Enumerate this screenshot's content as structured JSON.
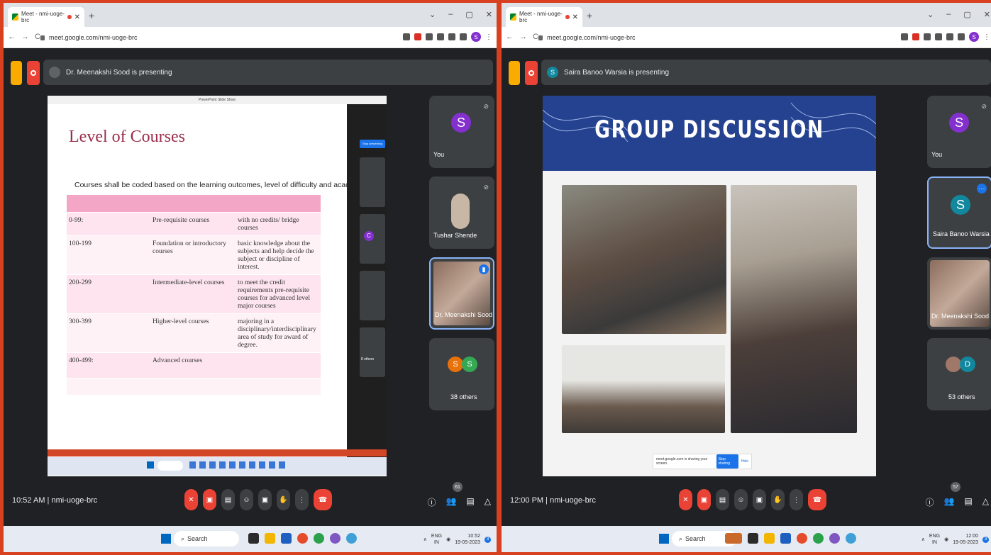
{
  "left": {
    "tab_title": "Meet - nmi-uoge-brc",
    "url": "meet.google.com/nmi-uoge-brc",
    "presenter_text": "Dr. Meenakshi Sood is presenting",
    "slide": {
      "title": "Level of Courses",
      "subtitle": "Courses shall be coded based on the learning outcomes, level of difficulty and academic rigor.",
      "rows": [
        [
          "0-99:",
          "Pre-requisite courses",
          "with no credits/ bridge courses"
        ],
        [
          "100-199",
          "Foundation or introductory courses",
          "basic knowledge about the subjects and help decide the subject or discipline of interest."
        ],
        [
          "200-299",
          "Intermediate-level courses",
          "to meet the credit requirements pre-requisite courses for advanced level major courses"
        ],
        [
          "300-399",
          "Higher-level courses",
          "majoring in a disciplinary/interdisciplinary area of study for award of degree."
        ],
        [
          "400-499:",
          "Advanced courses",
          ""
        ]
      ],
      "inner_stop_label": "Stop presenting",
      "inner_others": "8 others"
    },
    "tiles": [
      {
        "initial": "S",
        "name": "You",
        "color": "#8430ce"
      },
      {
        "initial": "",
        "name": "Tushar Shende",
        "color": "#c9b7a6"
      },
      {
        "initial": "",
        "name": "Dr. Meenakshi Sood",
        "color": "#a0786a"
      },
      {
        "initial": "",
        "name": "38 others",
        "color": ""
      }
    ],
    "others_avatars": [
      "S",
      "S"
    ],
    "clock": "10:52 AM",
    "meeting_code": "nmi-uoge-brc",
    "participants_count": "61",
    "taskbar": {
      "search": "Search",
      "lang1": "ENG",
      "lang2": "IN",
      "time": "10:52",
      "date": "19-05-2023",
      "notif": "3"
    }
  },
  "right": {
    "tab_title": "Meet - nmi-uoge-brc",
    "url": "meet.google.com/nmi-uoge-brc",
    "presenter_text": "Saira Banoo Warsia is presenting",
    "slide": {
      "title": "GROUP DISCUSSION",
      "share_text": "meet.google.com is sharing your screen.",
      "stop_label": "Stop sharing",
      "hide_label": "Hide"
    },
    "tiles": [
      {
        "initial": "S",
        "name": "You",
        "color": "#8430ce"
      },
      {
        "initial": "S",
        "name": "Saira Banoo Warsia",
        "color": "#12889e"
      },
      {
        "initial": "",
        "name": "Dr. Meenakshi Sood",
        "color": "#a0786a"
      },
      {
        "initial": "",
        "name": "53 others",
        "color": ""
      }
    ],
    "others_avatars": [
      "",
      "D"
    ],
    "clock": "12:00 PM",
    "meeting_code": "nmi-uoge-brc",
    "participants_count": "57",
    "taskbar": {
      "search": "Search",
      "lang1": "ENG",
      "lang2": "IN",
      "time": "12:00",
      "date": "19-05-2023",
      "notif": "3"
    }
  },
  "colors": {
    "frame": "#d8401f",
    "meet_bg": "#202124",
    "tile_bg": "#3c4043",
    "red": "#ea4335"
  }
}
